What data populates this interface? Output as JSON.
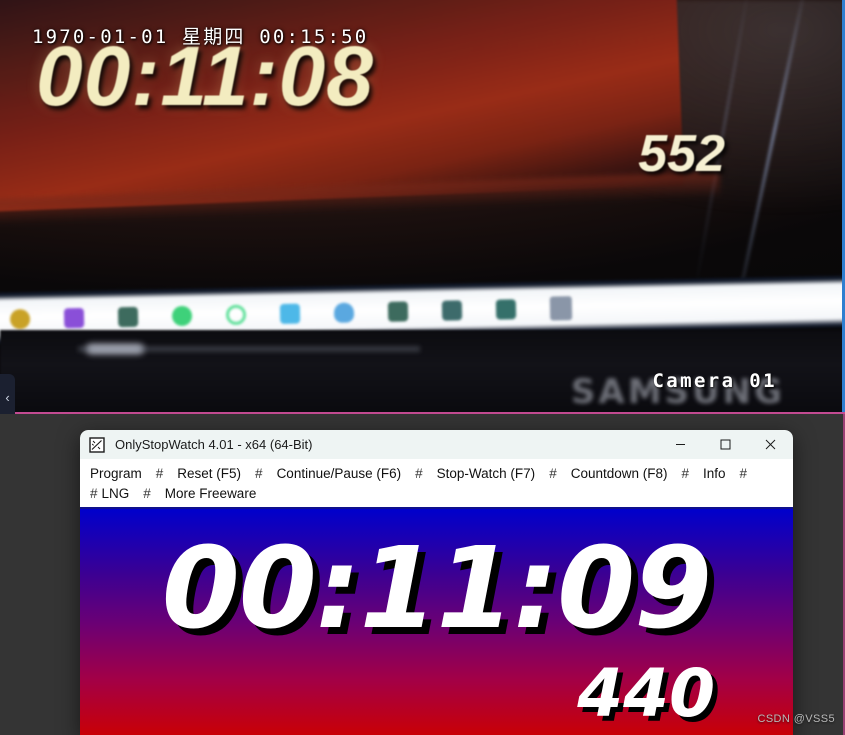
{
  "camera": {
    "osd_timestamp": "1970-01-01  星期四  00:15:50",
    "camera_label": "Camera 01",
    "screen_time": "00:11:08",
    "screen_ms": "552",
    "monitor_brand": "SAMSUNG",
    "collapse_icon": "‹",
    "border_right_color": "#2f7fd0",
    "border_bottom_color": "#c34b92",
    "taskbar_icons": [
      {
        "name": "edge-icon",
        "color": "#c9a227"
      },
      {
        "name": "vscode-icon",
        "color": "#8a4fd8"
      },
      {
        "name": "explorer-icon",
        "color": "#3d6b5e"
      },
      {
        "name": "spotify-icon",
        "color": "#3ed17a"
      },
      {
        "name": "loading-icon",
        "color": "#5fe09a"
      },
      {
        "name": "notepad-icon",
        "color": "#4db8e8"
      },
      {
        "name": "download-icon",
        "color": "#5aa8e0"
      },
      {
        "name": "app-green-icon",
        "color": "#3d6b5e"
      },
      {
        "name": "app-teal-icon",
        "color": "#3d6b6b"
      },
      {
        "name": "app-teal2-icon",
        "color": "#35706a"
      },
      {
        "name": "calculator-icon",
        "color": "#8a96a8"
      }
    ]
  },
  "window": {
    "title": "OnlyStopWatch 4.01 - x64 (64-Bit)",
    "icon_name": "stopwatch-chart-icon",
    "controls": {
      "minimize": "—",
      "maximize": "□",
      "close": "✕"
    }
  },
  "menu": {
    "separator": "#",
    "row1": [
      "Program",
      "Reset  (F5)",
      "Continue/Pause (F6)",
      "Stop-Watch  (F7)",
      "Countdown  (F8)",
      "Info"
    ],
    "row2": [
      "LNG",
      "More Freeware"
    ]
  },
  "stopwatch": {
    "time": "00:11:09",
    "milliseconds": "440",
    "gradient_top": "#0000cc",
    "gradient_bottom": "#cc0000",
    "text_color": "#ffffff",
    "shadow_color": "#000000"
  },
  "watermark": "CSDN @VSS5"
}
